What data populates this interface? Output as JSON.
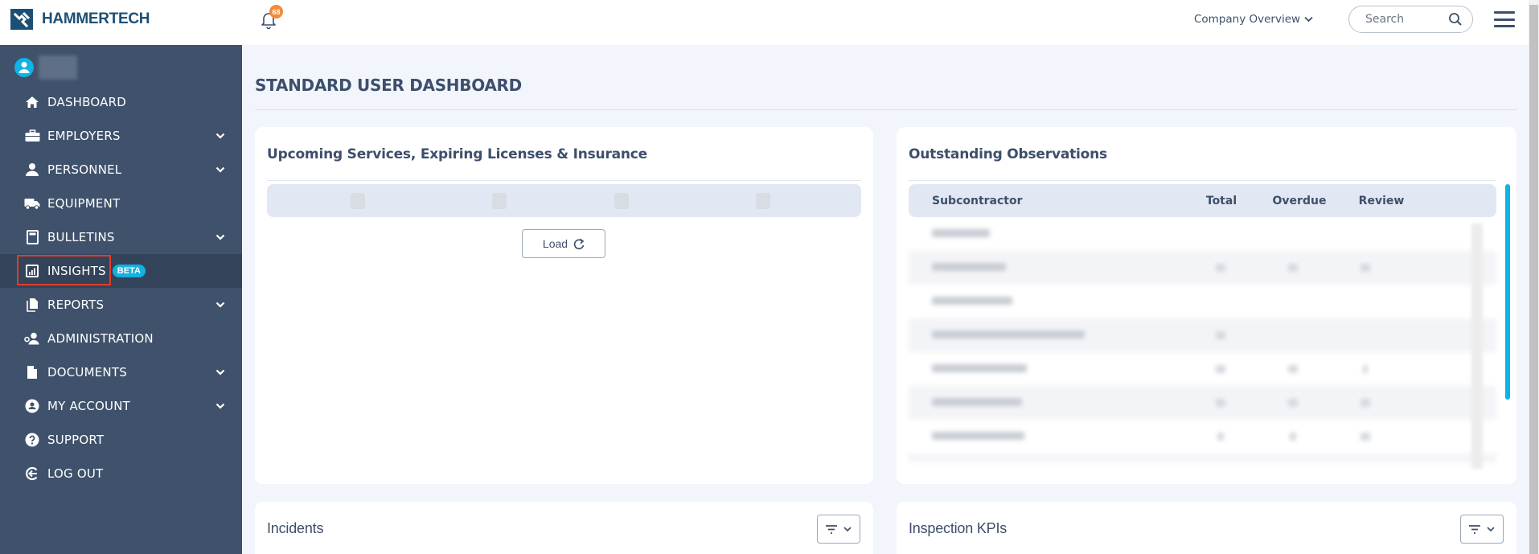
{
  "app": {
    "brand": "HAMMERTECH",
    "notifications_count": "68",
    "company_selector": "Company Overview",
    "search": {
      "placeholder": "Search",
      "value": ""
    }
  },
  "sidebar": {
    "user_name": "",
    "items": [
      {
        "label": "DASHBOARD",
        "icon": "home-icon",
        "has_submenu": false
      },
      {
        "label": "EMPLOYERS",
        "icon": "briefcase-icon",
        "has_submenu": true
      },
      {
        "label": "PERSONNEL",
        "icon": "person-icon",
        "has_submenu": true
      },
      {
        "label": "EQUIPMENT",
        "icon": "truck-icon",
        "has_submenu": false
      },
      {
        "label": "BULLETINS",
        "icon": "bulletin-icon",
        "has_submenu": true
      },
      {
        "label": "INSIGHTS",
        "icon": "chart-icon",
        "has_submenu": false,
        "badge": "BETA",
        "active": true
      },
      {
        "label": "REPORTS",
        "icon": "reports-icon",
        "has_submenu": true
      },
      {
        "label": "ADMINISTRATION",
        "icon": "admin-icon",
        "has_submenu": false
      },
      {
        "label": "DOCUMENTS",
        "icon": "document-icon",
        "has_submenu": true
      },
      {
        "label": "MY ACCOUNT",
        "icon": "account-icon",
        "has_submenu": true
      },
      {
        "label": "SUPPORT",
        "icon": "question-icon",
        "has_submenu": false
      },
      {
        "label": "LOG OUT",
        "icon": "logout-icon",
        "has_submenu": false
      }
    ]
  },
  "main": {
    "page_title": "STANDARD USER DASHBOARD",
    "cards": {
      "upcoming": {
        "title": "Upcoming Services, Expiring Licenses & Insurance",
        "load_label": "Load"
      },
      "observations": {
        "title": "Outstanding Observations",
        "columns": [
          "Subcontractor",
          "Total",
          "Overdue",
          "Review"
        ]
      },
      "incidents": {
        "title": "Incidents"
      },
      "inspection_kpis": {
        "title": "Inspection KPIs"
      }
    }
  },
  "colors": {
    "sidebar_bg": "#3f516b",
    "sidebar_active": "#33435a",
    "accent": "#0db4e4",
    "brand": "#1d4f75",
    "badge_orange": "#f28a3a",
    "highlight_red": "#e23d26"
  }
}
